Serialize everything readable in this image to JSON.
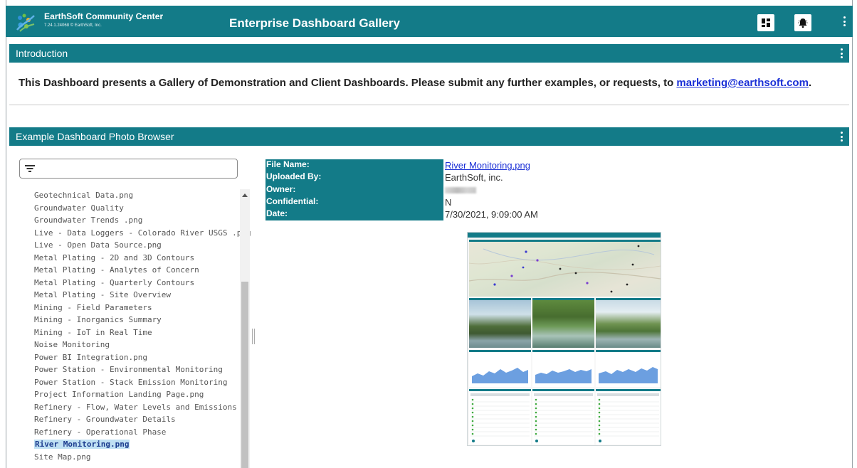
{
  "app": {
    "brand_name": "EarthSoft Community Center",
    "brand_version": "7.24.1.24068 © EarthSoft, Inc.",
    "title": "Enterprise Dashboard Gallery",
    "icons": [
      "dashboard-layout-icon",
      "alert-bell-icon",
      "more-vert-icon"
    ]
  },
  "intro": {
    "header": "Introduction",
    "text_before": "This Dashboard presents a Gallery of Demonstration and Client Dashboards. Please submit any further examples, or requests, to ",
    "email": "marketing@earthsoft.com",
    "text_after": "."
  },
  "browser": {
    "header": "Example Dashboard Photo Browser",
    "filter_placeholder": "",
    "files": [
      "Geotechnical Data.png",
      "Groundwater Quality",
      "Groundwater Trends .png",
      "Live - Data Loggers - Colorado River USGS .png",
      "Live - Open Data Source.png",
      "Metal Plating - 2D and 3D Contours",
      "Metal Plating - Analytes of Concern",
      "Metal Plating - Quarterly Contours",
      "Metal Plating - Site Overview",
      "Mining - Field Parameters",
      "Mining - Inorganics Summary",
      "Mining - IoT in Real Time",
      "Noise Monitoring",
      "Power BI Integration.png",
      "Power Station - Environmental Monitoring",
      "Power Station - Stack Emission Monitoring",
      "Project Information Landing Page.png",
      "Refinery - Flow, Water Levels and Emissions",
      "Refinery - Groundwater Details",
      "Refinery - Operational Phase",
      "River Monitoring.png",
      "Site Map.png"
    ],
    "selected": "River Monitoring.png"
  },
  "details": {
    "file_name_label": "File Name:",
    "file_name": "River Monitoring.png",
    "uploaded_by_label": "Uploaded By:",
    "uploaded_by": "EarthSoft, inc.",
    "owner_label": "Owner:",
    "confidential_label": "Confidential:",
    "confidential": "N",
    "date_label": "Date:",
    "date": "7/30/2021, 9:09:00 AM"
  },
  "colors": {
    "teal": "#137b88",
    "link": "#1a2fd6",
    "selection": "#bfe0f3"
  }
}
